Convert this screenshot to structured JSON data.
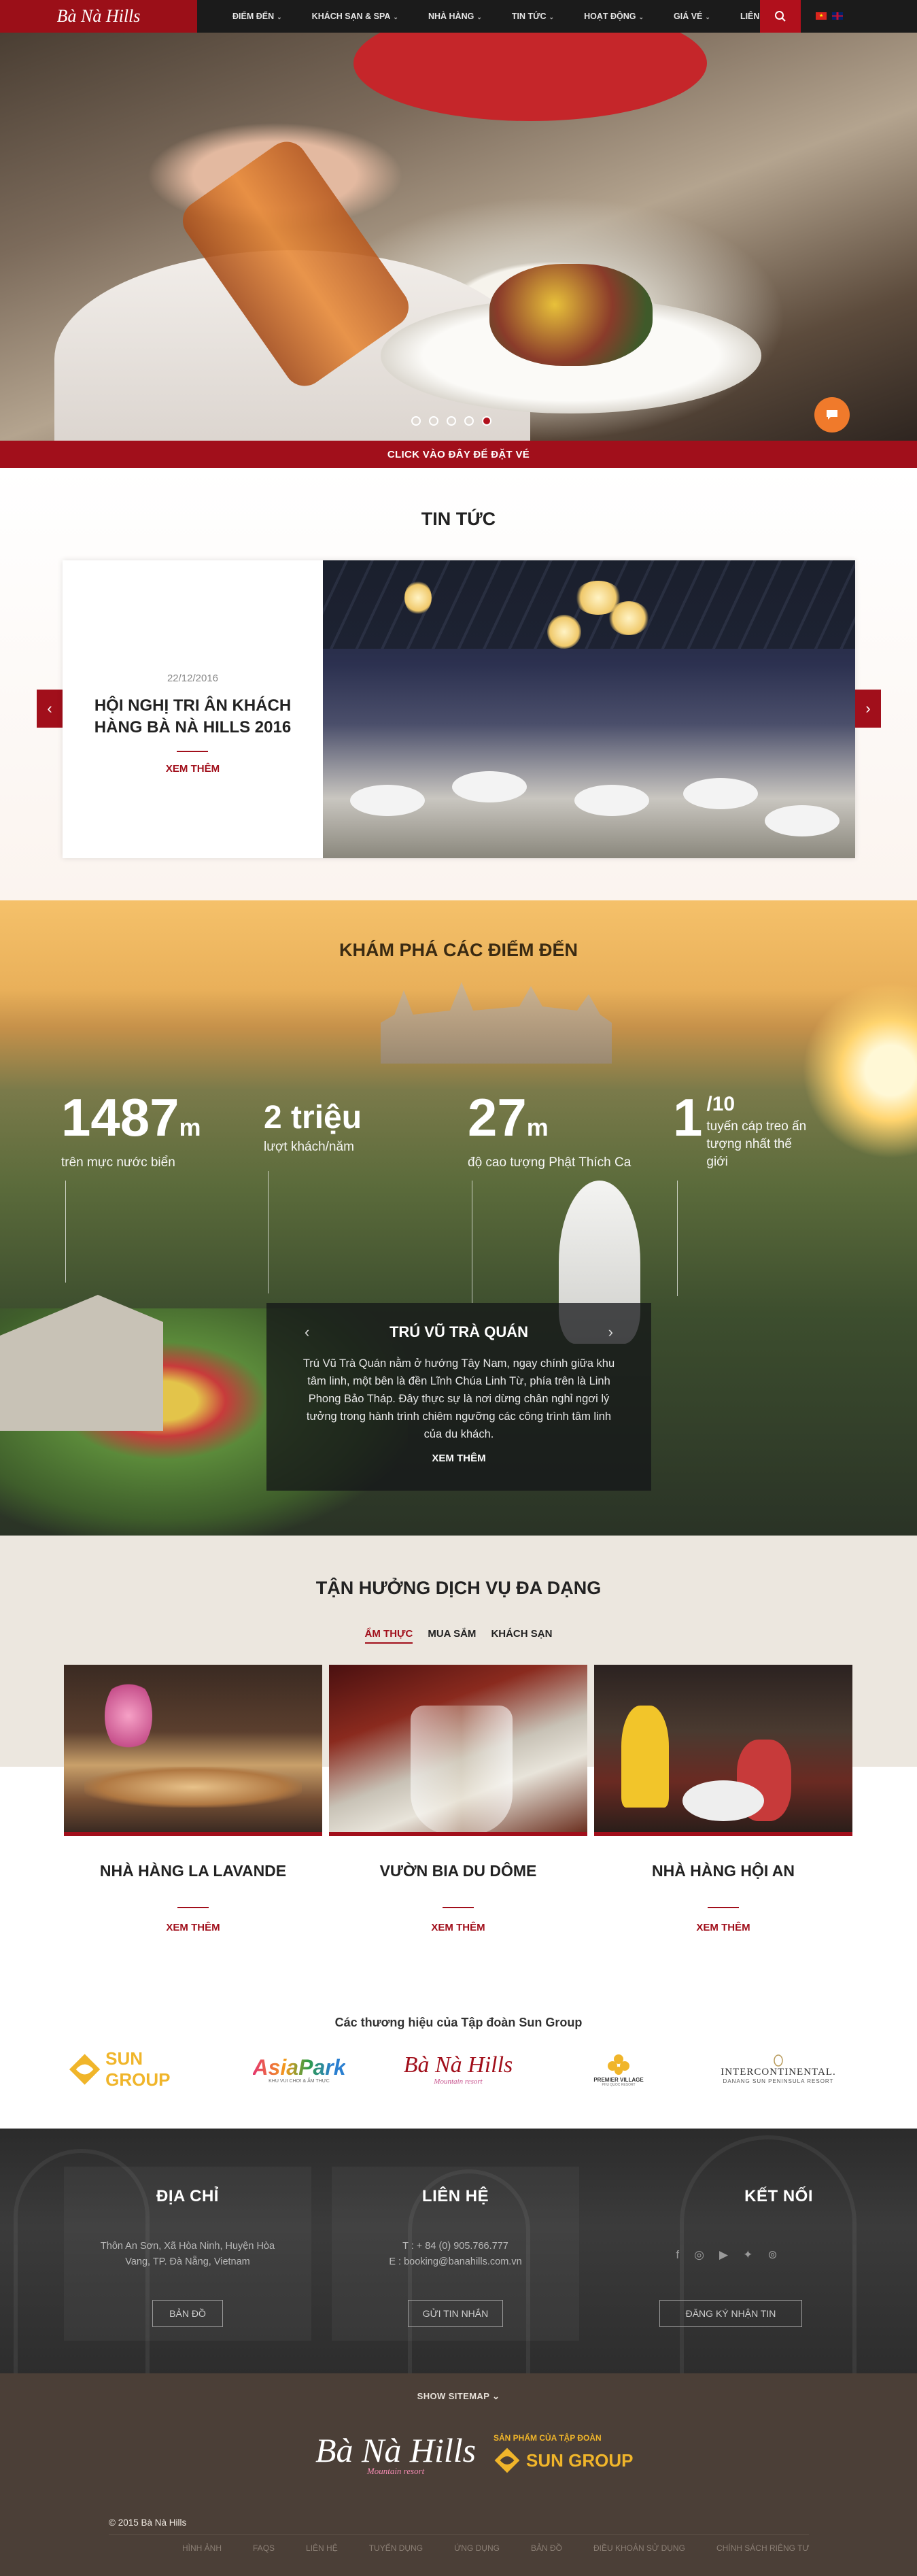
{
  "nav": {
    "logo": "Bà Nà Hills",
    "items": [
      {
        "label": "ĐIỂM ĐẾN",
        "dropdown": true
      },
      {
        "label": "KHÁCH SẠN & SPA",
        "dropdown": true
      },
      {
        "label": "NHÀ HÀNG",
        "dropdown": true
      },
      {
        "label": "TIN TỨC",
        "dropdown": true
      },
      {
        "label": "HOẠT ĐỘNG",
        "dropdown": true
      },
      {
        "label": "GIÁ VÉ",
        "dropdown": true
      },
      {
        "label": "LIÊN HỆ",
        "dropdown": false
      }
    ],
    "search_icon": "search-icon",
    "languages": [
      "vietnamese-flag-icon",
      "english-flag-icon"
    ]
  },
  "hero": {
    "slides": 5,
    "active_slide": 5,
    "chat_icon": "chat-icon"
  },
  "booking_bar": "CLICK VÀO ĐÂY ĐỂ ĐẶT VÉ",
  "news": {
    "title": "TIN TỨC",
    "item": {
      "date": "22/12/2016",
      "headline": "HỘI NGHỊ TRI ÂN KHÁCH HÀNG BÀ NÀ HILLS 2016",
      "more": "XEM THÊM"
    },
    "prev_icon": "chevron-left-icon",
    "next_icon": "chevron-right-icon"
  },
  "discover": {
    "title": "KHÁM PHÁ CÁC ĐIỂM ĐẾN",
    "stats": [
      {
        "value": "1487",
        "unit": "m",
        "label": "trên mực nước biển"
      },
      {
        "value": "2 triệu",
        "unit": "",
        "label": "lượt khách/năm"
      },
      {
        "value": "27",
        "unit": "m",
        "label": "độ cao tượng Phật Thích Ca"
      },
      {
        "value": "1",
        "unit": "/10",
        "label": "tuyến cáp treo ấn tượng nhất thế giới"
      }
    ],
    "panel": {
      "title": "TRÚ VŨ TRÀ QUÁN",
      "description": "Trú Vũ Trà Quán nằm ở hướng Tây Nam, ngay chính giữa khu tâm linh, một bên là đền Lĩnh Chúa Linh Từ, phía trên là Linh Phong Bảo Tháp. Đây thực sự là nơi dừng chân nghỉ ngơi lý tưởng trong hành trình chiêm ngưỡng các công trình tâm linh của du khách.",
      "more": "XEM THÊM"
    }
  },
  "services": {
    "title": "TẬN HƯỞNG DỊCH VỤ ĐA DẠNG",
    "tabs": [
      {
        "label": "ẨM THỰC",
        "active": true
      },
      {
        "label": "MUA SẮM",
        "active": false
      },
      {
        "label": "KHÁCH SẠN",
        "active": false
      }
    ],
    "cards": [
      {
        "name": "NHÀ HÀNG LA LAVANDE",
        "more": "XEM THÊM"
      },
      {
        "name": "VƯỜN BIA DU DÔME",
        "more": "XEM THÊM"
      },
      {
        "name": "NHÀ HÀNG HỘI AN",
        "more": "XEM THÊM"
      }
    ]
  },
  "brands": {
    "title": "Các thương hiệu của Tập đoàn Sun Group",
    "logos": [
      {
        "name": "SUN GROUP"
      },
      {
        "name": "AsiaPark",
        "tagline": "KHU VUI CHƠI & ẨM THỰC"
      },
      {
        "name": "Bà Nà Hills",
        "tagline": "Mountain resort"
      },
      {
        "name": "PREMIER VILLAGE",
        "tagline": "PHU QUOC RESORT"
      },
      {
        "name": "INTERCONTINENTAL.",
        "tagline": "DANANG SUN PENINSULA RESORT"
      }
    ]
  },
  "footer": {
    "address": {
      "title": "ĐỊA CHỈ",
      "text": "Thôn An Sơn, Xã Hòa Ninh, Huyện Hòa Vang, TP. Đà Nẵng, Vietnam",
      "button": "BẢN ĐỒ"
    },
    "contact": {
      "title": "LIÊN HỆ",
      "phone": "T : + 84 (0) 905.766.777",
      "email": "E : booking@banahills.com.vn",
      "button": "GỬI TIN NHẮN"
    },
    "connect": {
      "title": "KẾT NỐI",
      "socials": [
        "facebook-icon",
        "instagram-icon",
        "youtube-icon",
        "twitter-icon",
        "tripadvisor-icon"
      ],
      "button": "ĐĂNG KÝ NHẬN TIN"
    }
  },
  "bottom": {
    "sitemap": "SHOW SITEMAP",
    "logo": "Bà Nà Hills",
    "logo_sub": "Mountain resort",
    "product_of": "SẢN PHẨM CỦA TẬP ĐOÀN",
    "sungroup": "SUN GROUP",
    "copyright": "© 2015 Bà Nà Hills",
    "links": [
      "HÌNH ẢNH",
      "FAQS",
      "LIÊN HỆ",
      "TUYỂN DỤNG",
      "ỨNG DỤNG",
      "BẢN ĐỒ",
      "ĐIỀU KHOẢN SỬ DỤNG",
      "CHÍNH SÁCH RIÊNG TƯ"
    ]
  },
  "colors": {
    "brand_red": "#a10f1b",
    "nav_bg": "#1b1b1b",
    "footer_bg": "#2d2d2d",
    "bottom_bg": "#4b3f37",
    "accent_orange": "#f07a2b"
  }
}
